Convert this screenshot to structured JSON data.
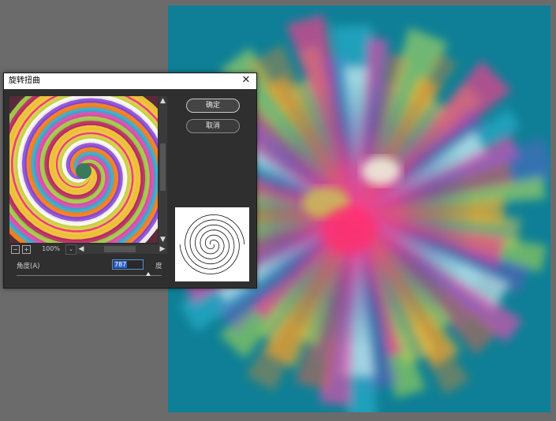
{
  "dialog": {
    "title": "旋转扭曲",
    "close_symbol": "✕",
    "ok_label": "确定",
    "cancel_label": "取消"
  },
  "preview": {
    "zoom_out_symbol": "−",
    "zoom_in_symbol": "+",
    "zoom_value": "100%",
    "zoom_dropdown_symbol": "⌄",
    "scroll_up_symbol": "▲",
    "scroll_down_symbol": "▼",
    "scroll_left_symbol": "◀",
    "scroll_right_symbol": "▶"
  },
  "angle": {
    "label": "角度(A)",
    "value": "787",
    "unit": "度",
    "slider_fraction": 0.906
  },
  "icons": {
    "close": "close-icon",
    "swirl_preview": "swirl-preview-image",
    "swirl_thumbnail": "swirl-thumbnail-icon"
  },
  "colors": {
    "canvas_bg": "#0e7f96",
    "dialog_bg": "#2f2f2f",
    "workspace_bg": "#6b6b6b",
    "selection": "#2b63c7"
  }
}
